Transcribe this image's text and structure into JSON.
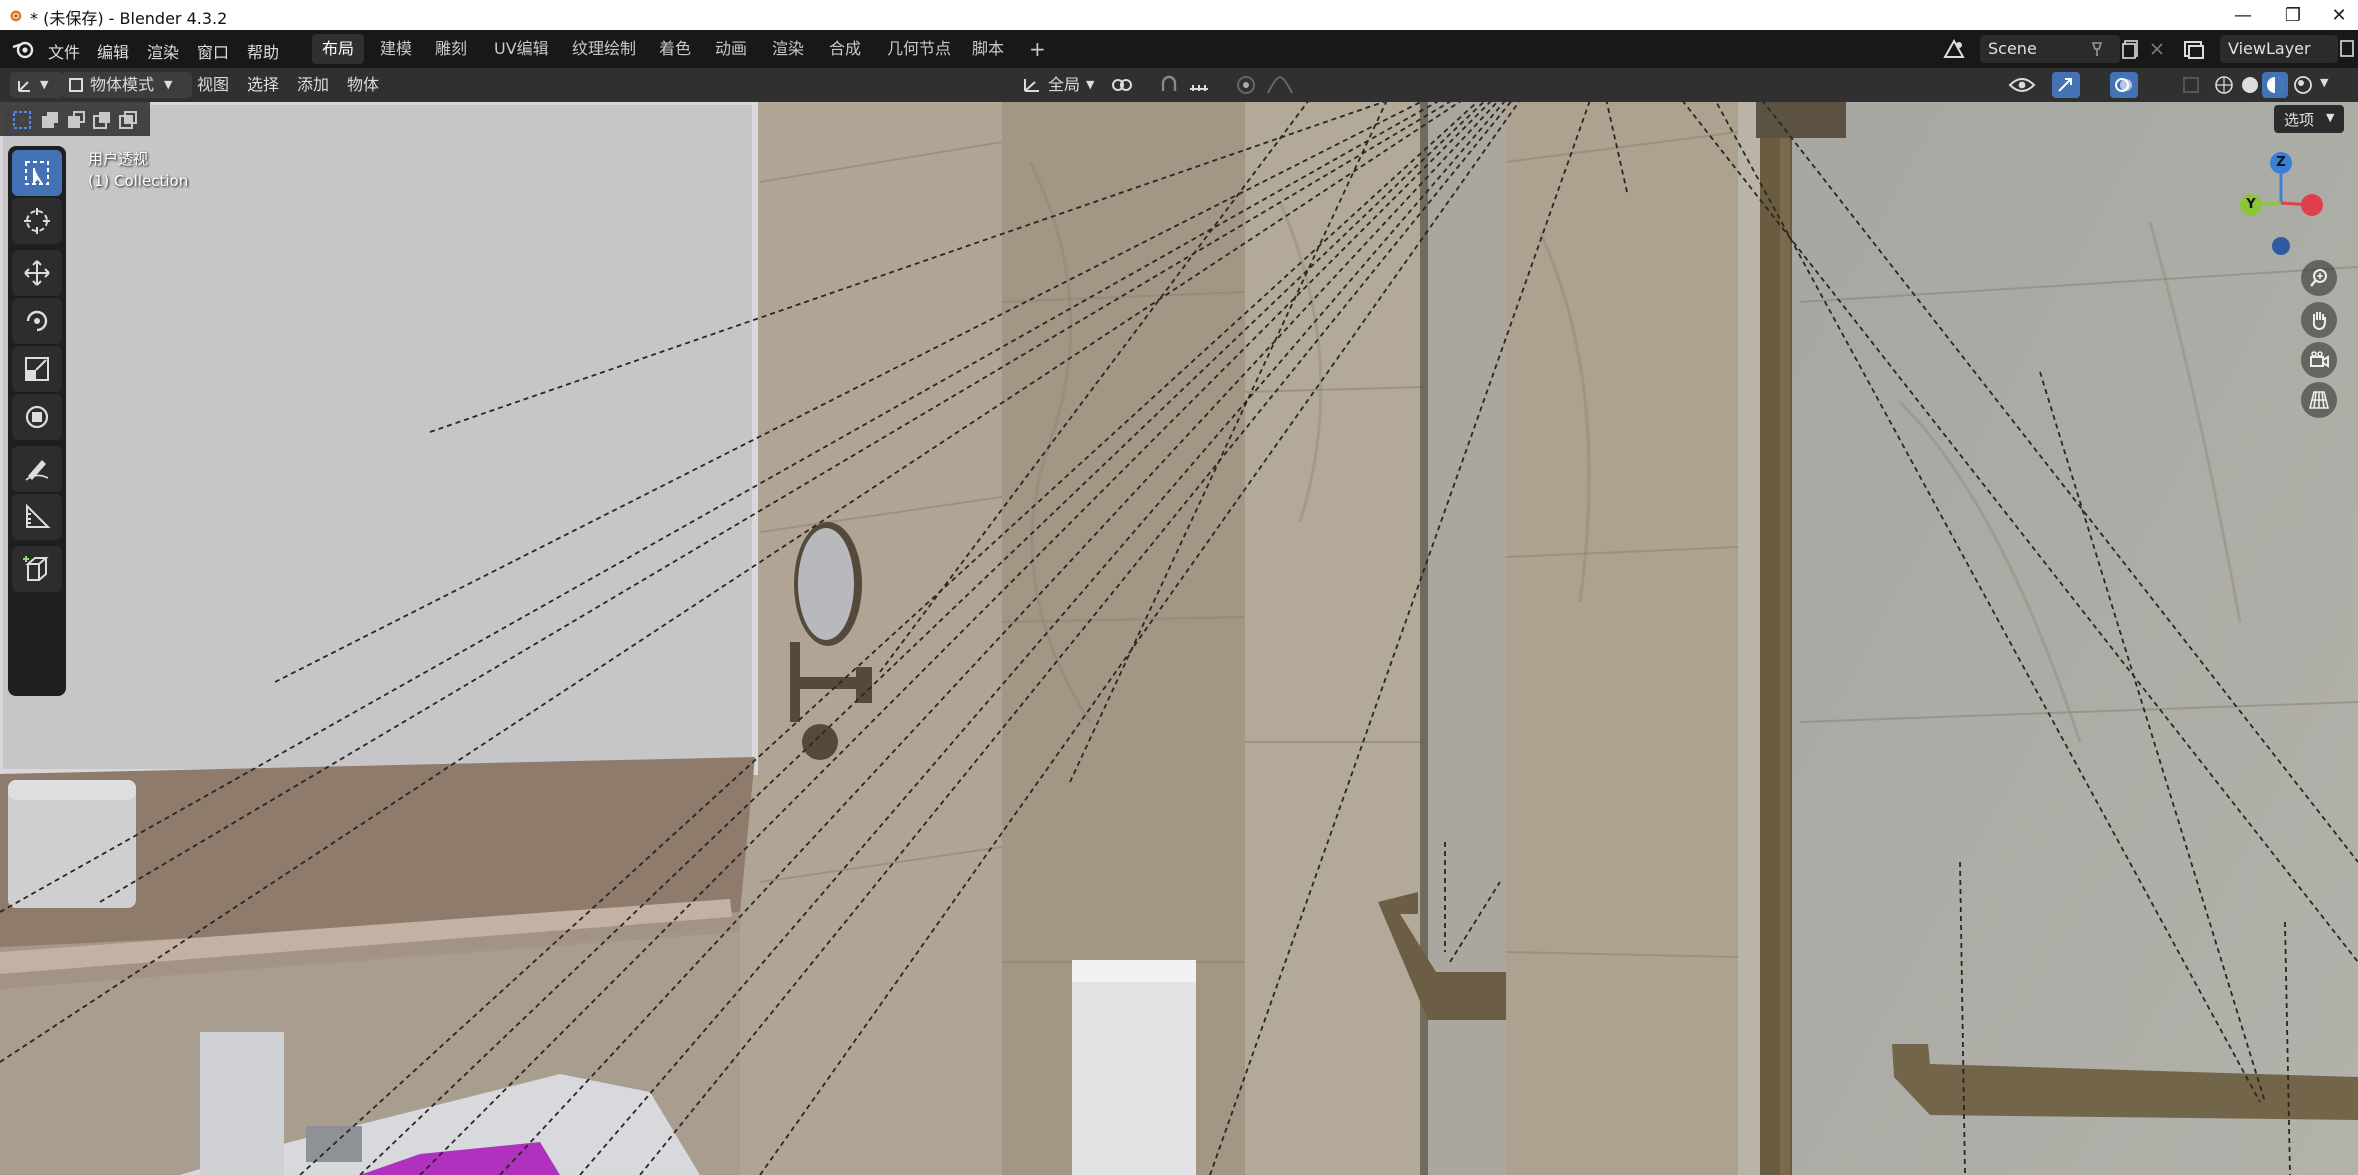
{
  "window": {
    "title": "* (未保存) - Blender 4.3.2",
    "minimize_glyph": "—",
    "restore_glyph": "❐",
    "close_glyph": "✕"
  },
  "menu": {
    "items": [
      "文件",
      "编辑",
      "渲染",
      "窗口",
      "帮助"
    ]
  },
  "workspaces": {
    "tabs": [
      "布局",
      "建模",
      "雕刻",
      "UV编辑",
      "纹理绘制",
      "着色",
      "动画",
      "渲染",
      "合成",
      "几何节点",
      "脚本"
    ],
    "active_index": 0,
    "add_glyph": "+"
  },
  "scene": {
    "name": "Scene"
  },
  "view_layer": {
    "name": "ViewLayer"
  },
  "viewport_header": {
    "mode": "物体模式",
    "view": "视图",
    "select": "选择",
    "add": "添加",
    "object": "物体",
    "transform_orientation": "全局",
    "options": "选项"
  },
  "viewport": {
    "view_name": "用户透视",
    "collection": "(1) Collection",
    "gizmo": {
      "x_label": "",
      "y_label": "Y",
      "z_label": "Z",
      "x_color": "#e0404a",
      "y_color": "#8ac53a",
      "z_color": "#3a7fd8"
    }
  },
  "icons": [
    "blender-logo-icon",
    "editor-type-icon",
    "object-mode-icon",
    "select-box-icon",
    "cursor-icon",
    "move-icon",
    "rotate-icon",
    "scale-icon",
    "transform-icon",
    "annotate-icon",
    "measure-icon",
    "add-cube-icon",
    "zoom-icon",
    "pan-hand-icon",
    "camera-icon",
    "grid-icon",
    "wireframe-shading-icon",
    "solid-shading-icon",
    "material-shading-icon",
    "rendered-shading-icon"
  ],
  "colors": {
    "accent": "#4472b6",
    "header_bg": "#303030",
    "topbar_bg": "#181818"
  }
}
